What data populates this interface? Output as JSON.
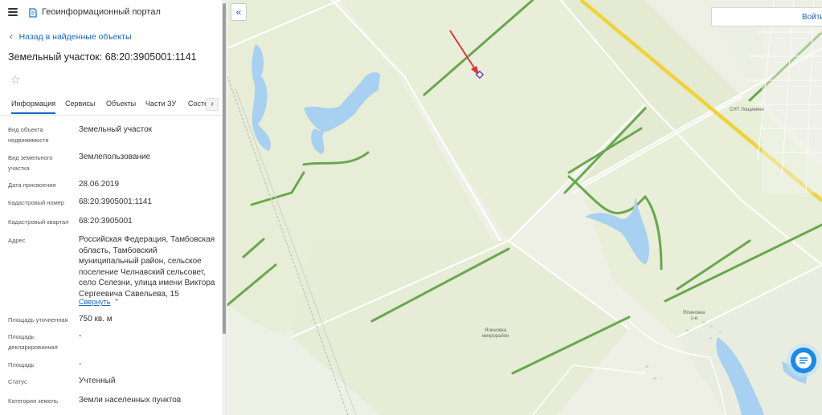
{
  "header": {
    "portal_title": "Геоинформационный портал",
    "menu_icon": "hamburger-menu-icon",
    "logo_icon": "portal-logo-icon"
  },
  "navigation": {
    "back_label": "Назад в найденные объекты"
  },
  "object": {
    "title": "Земельный участок: 68:20:3905001:1141",
    "favorite_icon": "star-outline-icon"
  },
  "tabs": [
    {
      "label": "Информация",
      "active": true
    },
    {
      "label": "Сервисы",
      "active": false
    },
    {
      "label": "Объекты",
      "active": false
    },
    {
      "label": "Части ЗУ",
      "active": false
    },
    {
      "label": "Состе",
      "active": false
    }
  ],
  "properties": [
    {
      "label": "Вид объекта недвижимости",
      "value": "Земельный участок"
    },
    {
      "label": "Вид земельного участка",
      "value": "Землепользование"
    },
    {
      "label": "Дата присвоения",
      "value": "28.06.2019"
    },
    {
      "label": "Кадастровый номер",
      "value": "68:20:3905001:1141"
    },
    {
      "label": "Кадастровый квартал",
      "value": "68:20:3905001"
    },
    {
      "label": "Адрес",
      "value": "Российская Федерация, Тамбовская область, Тамбовский муниципальный район, сельское поселение Челнавский сельсовет, село Селезни, улица имени Виктора Сергеевича Савельева, 15"
    },
    {
      "label": "Площадь уточненная",
      "value": "750 кв. м"
    },
    {
      "label": "Площадь декларированная",
      "value": "-"
    },
    {
      "label": "Площадь",
      "value": "-"
    },
    {
      "label": "Статус",
      "value": "Учтенный"
    },
    {
      "label": "Категория земель",
      "value": "Земли населенных пунктов"
    }
  ],
  "address_toggle": {
    "label": "Свернуть",
    "icon": "chevron-up-icon"
  },
  "map": {
    "login_label": "Войти",
    "collapse_icon": "double-chevron-left-icon",
    "chat_icon": "chat-bubble-icon",
    "labels": {
      "settlement_1": "Ялиновка\n1-я",
      "microdistrict": "Ялиновка\nмикрорайон",
      "snt": "СНТ Лощинино"
    },
    "colors": {
      "field": "#e6ecd5",
      "water": "#a8d0f0",
      "forest_edge": "#6aa84f",
      "road": "#f0d84a",
      "marker": "#7b3fbf",
      "arrow": "#d93a3a",
      "accent": "#1565c0"
    }
  }
}
